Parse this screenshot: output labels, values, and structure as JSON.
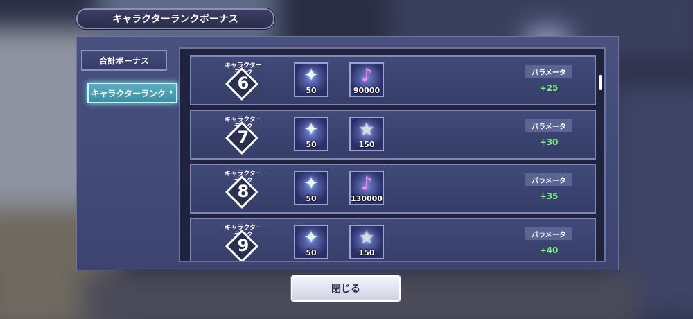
{
  "title": "キャラクターランクボーナス",
  "tabs": [
    {
      "label": "合計ボーナス",
      "active": false
    },
    {
      "label": "キャラクターランク",
      "active": true
    }
  ],
  "rows": [
    {
      "rank_label": "キャラクター\nランク",
      "rank": "6",
      "crystal_qty": "50",
      "reward_icon": "music-disc-icon",
      "reward_qty": "90000",
      "param_label": "パラメータ",
      "param_value": "+25"
    },
    {
      "rank_label": "キャラクター\nランク",
      "rank": "7",
      "crystal_qty": "50",
      "reward_icon": "star-card-icon",
      "reward_qty": "150",
      "param_label": "パラメータ",
      "param_value": "+30"
    },
    {
      "rank_label": "キャラクター\nランク",
      "rank": "8",
      "crystal_qty": "50",
      "reward_icon": "music-disc-icon",
      "reward_qty": "130000",
      "param_label": "パラメータ",
      "param_value": "+35"
    },
    {
      "rank_label": "キャラクター\nランク",
      "rank": "9",
      "crystal_qty": "50",
      "reward_icon": "star-card-icon",
      "reward_qty": "150",
      "param_label": "パラメータ",
      "param_value": "+40"
    }
  ],
  "close_label": "閉じる",
  "colors": {
    "accent_tab": "#4ea3b5",
    "param_value": "#7df07f",
    "panel": "#434a78"
  }
}
